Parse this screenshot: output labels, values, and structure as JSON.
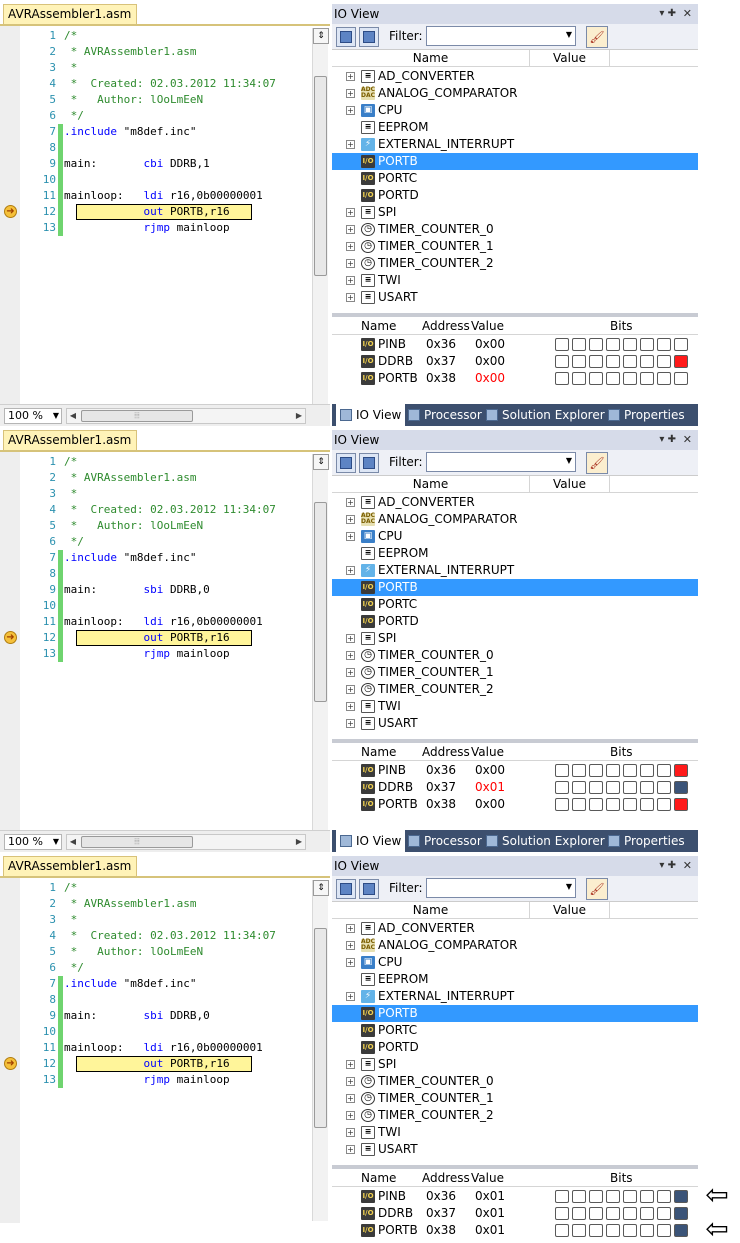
{
  "colors": {
    "bit_set_red": "#ff1a1a",
    "bit_set_blue": "#3b5478",
    "value_changed": "#ff0000",
    "selection": "#3399ff",
    "change_bar": "#6fd46f",
    "current_line": "#fff59a"
  },
  "panels": [
    {
      "editor": {
        "tab": "AVRAssembler1.asm",
        "zoom": "100 %",
        "lines": [
          {
            "n": "1",
            "text": "/*",
            "kind": "comment"
          },
          {
            "n": "2",
            "text": " * AVRAssembler1.asm",
            "kind": "comment"
          },
          {
            "n": "3",
            "text": " *",
            "kind": "comment"
          },
          {
            "n": "4",
            "text": " *  Created: 02.03.2012 11:34:07",
            "kind": "comment"
          },
          {
            "n": "5",
            "text": " *   Author: lOoLmEeN",
            "kind": "comment"
          },
          {
            "n": "6",
            "text": " */",
            "kind": "comment"
          },
          {
            "n": "7",
            "label": "",
            "dir": ".include",
            "args": " \"m8def.inc\"",
            "kind": "directive"
          },
          {
            "n": "8",
            "text": "",
            "kind": "code"
          },
          {
            "n": "9",
            "label": "main:       ",
            "mnem": "cbi",
            "args": " DDRB,1",
            "kind": "code"
          },
          {
            "n": "10",
            "text": "",
            "kind": "code"
          },
          {
            "n": "11",
            "label": "mainloop:   ",
            "mnem": "ldi",
            "args": " r16,0b00000001",
            "kind": "code"
          },
          {
            "n": "12",
            "label": "            ",
            "mnem": "out",
            "args": " PORTB,r16",
            "kind": "code"
          },
          {
            "n": "13",
            "label": "            ",
            "mnem": "rjmp",
            "args": " mainloop",
            "kind": "code"
          }
        ]
      },
      "io": {
        "title": "IO View",
        "filter_label": "Filter:",
        "col_name": "Name",
        "col_value": "Value",
        "bits_head": {
          "name": "Name",
          "address": "Address",
          "value": "Value",
          "bits": "Bits"
        },
        "registers": [
          {
            "name": "PINB",
            "address": "0x36",
            "value": "0x00",
            "changed": false,
            "bits": [
              0,
              0,
              0,
              0,
              0,
              0,
              0,
              0
            ],
            "color": "red"
          },
          {
            "name": "DDRB",
            "address": "0x37",
            "value": "0x00",
            "changed": false,
            "bits": [
              0,
              0,
              0,
              0,
              0,
              0,
              0,
              1
            ],
            "color": "red"
          },
          {
            "name": "PORTB",
            "address": "0x38",
            "value": "0x00",
            "changed": true,
            "bits": [
              0,
              0,
              0,
              0,
              0,
              0,
              0,
              0
            ],
            "color": "red"
          }
        ],
        "tabs": [
          "IO View",
          "Processor",
          "Solution Explorer",
          "Properties"
        ],
        "arrows": [
          false,
          false,
          false
        ]
      }
    },
    {
      "editor": {
        "tab": "AVRAssembler1.asm",
        "zoom": "100 %",
        "lines": [
          {
            "n": "1",
            "text": "/*",
            "kind": "comment"
          },
          {
            "n": "2",
            "text": " * AVRAssembler1.asm",
            "kind": "comment"
          },
          {
            "n": "3",
            "text": " *",
            "kind": "comment"
          },
          {
            "n": "4",
            "text": " *  Created: 02.03.2012 11:34:07",
            "kind": "comment"
          },
          {
            "n": "5",
            "text": " *   Author: lOoLmEeN",
            "kind": "comment"
          },
          {
            "n": "6",
            "text": " */",
            "kind": "comment"
          },
          {
            "n": "7",
            "label": "",
            "dir": ".include",
            "args": " \"m8def.inc\"",
            "kind": "directive"
          },
          {
            "n": "8",
            "text": "",
            "kind": "code"
          },
          {
            "n": "9",
            "label": "main:       ",
            "mnem": "sbi",
            "args": " DDRB,0",
            "kind": "code"
          },
          {
            "n": "10",
            "text": "",
            "kind": "code"
          },
          {
            "n": "11",
            "label": "mainloop:   ",
            "mnem": "ldi",
            "args": " r16,0b00000001",
            "kind": "code"
          },
          {
            "n": "12",
            "label": "            ",
            "mnem": "out",
            "args": " PORTB,r16",
            "kind": "code"
          },
          {
            "n": "13",
            "label": "            ",
            "mnem": "rjmp",
            "args": " mainloop",
            "kind": "code"
          }
        ]
      },
      "io": {
        "title": "IO View",
        "filter_label": "Filter:",
        "col_name": "Name",
        "col_value": "Value",
        "bits_head": {
          "name": "Name",
          "address": "Address",
          "value": "Value",
          "bits": "Bits"
        },
        "registers": [
          {
            "name": "PINB",
            "address": "0x36",
            "value": "0x00",
            "changed": false,
            "bits": [
              0,
              0,
              0,
              0,
              0,
              0,
              0,
              1
            ],
            "color": "red"
          },
          {
            "name": "DDRB",
            "address": "0x37",
            "value": "0x01",
            "changed": true,
            "bits": [
              0,
              0,
              0,
              0,
              0,
              0,
              0,
              1
            ],
            "color": "blue"
          },
          {
            "name": "PORTB",
            "address": "0x38",
            "value": "0x00",
            "changed": false,
            "bits": [
              0,
              0,
              0,
              0,
              0,
              0,
              0,
              1
            ],
            "color": "red"
          }
        ],
        "tabs": [
          "IO View",
          "Processor",
          "Solution Explorer",
          "Properties"
        ],
        "arrows": [
          false,
          false,
          false
        ]
      }
    },
    {
      "editor": {
        "tab": "AVRAssembler1.asm",
        "zoom": "",
        "lines": [
          {
            "n": "1",
            "text": "/*",
            "kind": "comment"
          },
          {
            "n": "2",
            "text": " * AVRAssembler1.asm",
            "kind": "comment"
          },
          {
            "n": "3",
            "text": " *",
            "kind": "comment"
          },
          {
            "n": "4",
            "text": " *  Created: 02.03.2012 11:34:07",
            "kind": "comment"
          },
          {
            "n": "5",
            "text": " *   Author: lOoLmEeN",
            "kind": "comment"
          },
          {
            "n": "6",
            "text": " */",
            "kind": "comment"
          },
          {
            "n": "7",
            "label": "",
            "dir": ".include",
            "args": " \"m8def.inc\"",
            "kind": "directive"
          },
          {
            "n": "8",
            "text": "",
            "kind": "code"
          },
          {
            "n": "9",
            "label": "main:       ",
            "mnem": "sbi",
            "args": " DDRB,0",
            "kind": "code"
          },
          {
            "n": "10",
            "text": "",
            "kind": "code"
          },
          {
            "n": "11",
            "label": "mainloop:   ",
            "mnem": "ldi",
            "args": " r16,0b00000001",
            "kind": "code"
          },
          {
            "n": "12",
            "label": "            ",
            "mnem": "out",
            "args": " PORTB,r16",
            "kind": "code"
          },
          {
            "n": "13",
            "label": "            ",
            "mnem": "rjmp",
            "args": " mainloop",
            "kind": "code"
          }
        ]
      },
      "io": {
        "title": "IO View",
        "filter_label": "Filter:",
        "col_name": "Name",
        "col_value": "Value",
        "bits_head": {
          "name": "Name",
          "address": "Address",
          "value": "Value",
          "bits": "Bits"
        },
        "registers": [
          {
            "name": "PINB",
            "address": "0x36",
            "value": "0x01",
            "changed": false,
            "bits": [
              0,
              0,
              0,
              0,
              0,
              0,
              0,
              1
            ],
            "color": "blue"
          },
          {
            "name": "DDRB",
            "address": "0x37",
            "value": "0x01",
            "changed": false,
            "bits": [
              0,
              0,
              0,
              0,
              0,
              0,
              0,
              1
            ],
            "color": "blue"
          },
          {
            "name": "PORTB",
            "address": "0x38",
            "value": "0x01",
            "changed": false,
            "bits": [
              0,
              0,
              0,
              0,
              0,
              0,
              0,
              1
            ],
            "color": "blue"
          }
        ],
        "tabs": [],
        "arrows": [
          true,
          false,
          true
        ]
      }
    }
  ],
  "tree_items": [
    {
      "name": "AD_CONVERTER",
      "icon": "doc",
      "expandable": true
    },
    {
      "name": "ANALOG_COMPARATOR",
      "icon": "adc",
      "expandable": true
    },
    {
      "name": "CPU",
      "icon": "cpu",
      "expandable": true
    },
    {
      "name": "EEPROM",
      "icon": "doc",
      "expandable": false
    },
    {
      "name": "EXTERNAL_INTERRUPT",
      "icon": "ext",
      "expandable": true
    },
    {
      "name": "PORTB",
      "icon": "io",
      "expandable": false,
      "selected": true
    },
    {
      "name": "PORTC",
      "icon": "io",
      "expandable": false
    },
    {
      "name": "PORTD",
      "icon": "io",
      "expandable": false
    },
    {
      "name": "SPI",
      "icon": "doc",
      "expandable": true
    },
    {
      "name": "TIMER_COUNTER_0",
      "icon": "clk",
      "expandable": true
    },
    {
      "name": "TIMER_COUNTER_1",
      "icon": "clk",
      "expandable": true
    },
    {
      "name": "TIMER_COUNTER_2",
      "icon": "clk",
      "expandable": true
    },
    {
      "name": "TWI",
      "icon": "doc",
      "expandable": true
    },
    {
      "name": "USART",
      "icon": "doc",
      "expandable": true
    }
  ],
  "icon_glyphs": {
    "doc": "≡",
    "adc": "ADC DAC",
    "cpu": "▣",
    "clk": "◷",
    "ext": "⚡",
    "io": "I/O"
  }
}
